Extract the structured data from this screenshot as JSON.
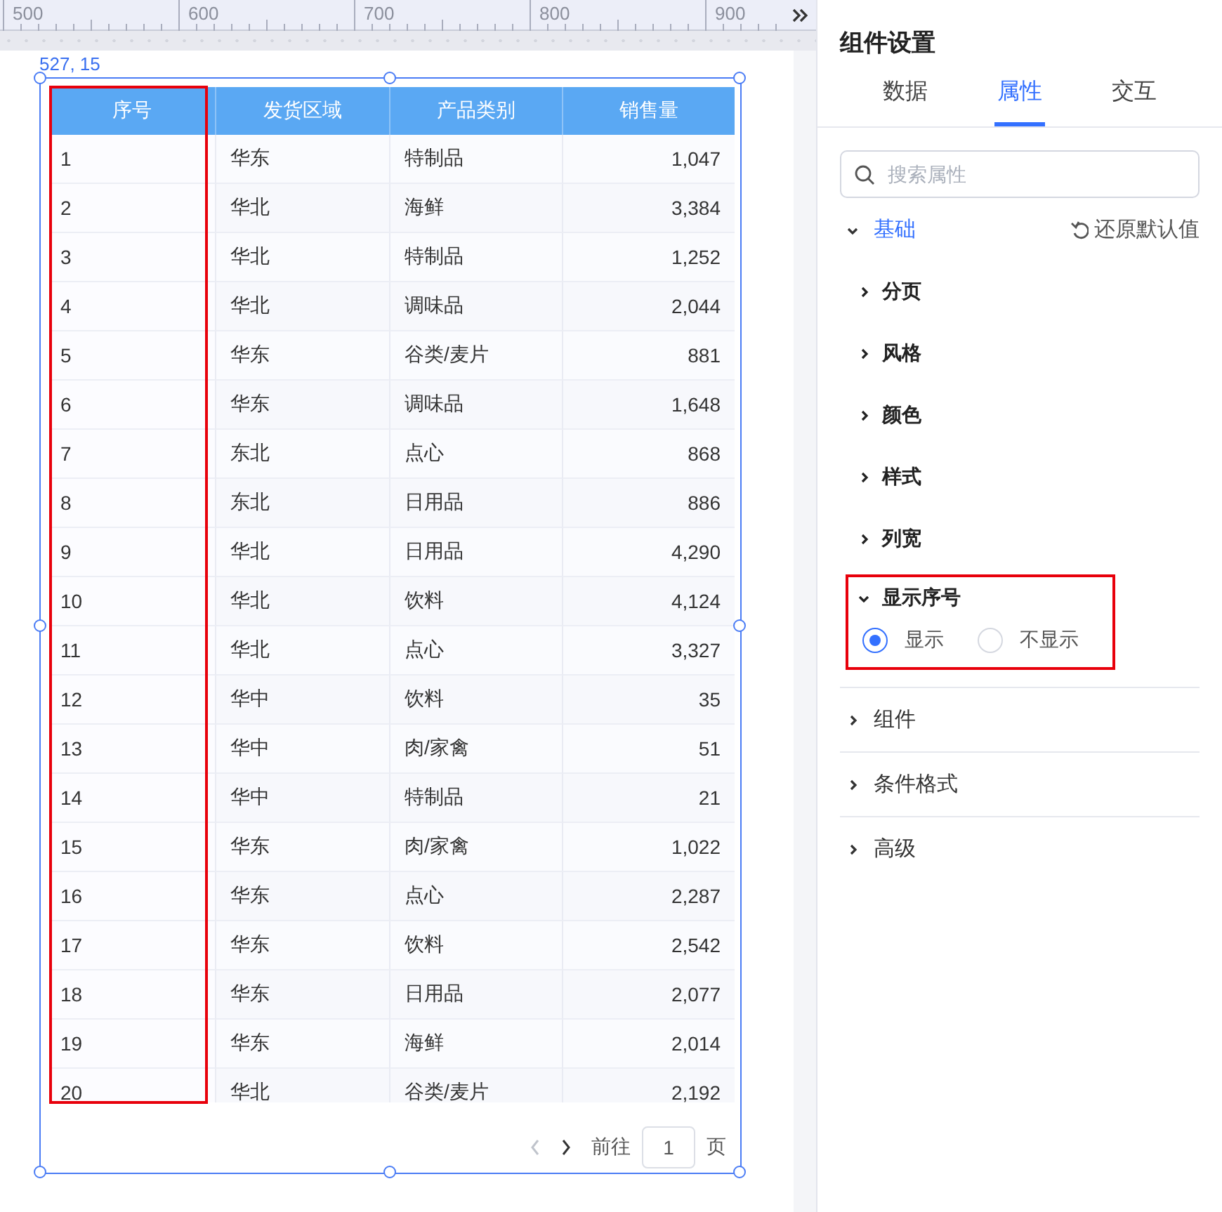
{
  "ruler": {
    "labels": [
      "500",
      "600",
      "700",
      "800",
      "900"
    ]
  },
  "canvas": {
    "coords": "527, 15",
    "table": {
      "columns": [
        {
          "label": "序号",
          "highlighted": true
        },
        {
          "label": "发货区域",
          "highlighted": false
        },
        {
          "label": "产品类别",
          "highlighted": false
        },
        {
          "label": "销售量",
          "highlighted": false
        }
      ],
      "rows": [
        [
          "1",
          "华东",
          "特制品",
          "1,047"
        ],
        [
          "2",
          "华北",
          "海鲜",
          "3,384"
        ],
        [
          "3",
          "华北",
          "特制品",
          "1,252"
        ],
        [
          "4",
          "华北",
          "调味品",
          "2,044"
        ],
        [
          "5",
          "华东",
          "谷类/麦片",
          "881"
        ],
        [
          "6",
          "华东",
          "调味品",
          "1,648"
        ],
        [
          "7",
          "东北",
          "点心",
          "868"
        ],
        [
          "8",
          "东北",
          "日用品",
          "886"
        ],
        [
          "9",
          "华北",
          "日用品",
          "4,290"
        ],
        [
          "10",
          "华北",
          "饮料",
          "4,124"
        ],
        [
          "11",
          "华北",
          "点心",
          "3,327"
        ],
        [
          "12",
          "华中",
          "饮料",
          "35"
        ],
        [
          "13",
          "华中",
          "肉/家禽",
          "51"
        ],
        [
          "14",
          "华中",
          "特制品",
          "21"
        ],
        [
          "15",
          "华东",
          "肉/家禽",
          "1,022"
        ],
        [
          "16",
          "华东",
          "点心",
          "2,287"
        ],
        [
          "17",
          "华东",
          "饮料",
          "2,542"
        ],
        [
          "18",
          "华东",
          "日用品",
          "2,077"
        ],
        [
          "19",
          "华东",
          "海鲜",
          "2,014"
        ],
        [
          "20",
          "华北",
          "谷类/麦片",
          "2,192"
        ]
      ]
    },
    "pagination": {
      "prev_disabled": true,
      "next_disabled": false,
      "goto_label": "前往",
      "page": "1",
      "page_suffix": "页"
    }
  },
  "panel": {
    "title": "组件设置",
    "tabs": [
      {
        "label": "数据",
        "selected": false
      },
      {
        "label": "属性",
        "selected": true
      },
      {
        "label": "交互",
        "selected": false
      }
    ],
    "search": {
      "placeholder": "搜索属性"
    },
    "groups": [
      {
        "label": "基础",
        "expanded": true,
        "reset": "还原默认值",
        "items": [
          {
            "label": "分页",
            "expanded": false,
            "highlighted": false
          },
          {
            "label": "风格",
            "expanded": false,
            "highlighted": false
          },
          {
            "label": "颜色",
            "expanded": false,
            "highlighted": false
          },
          {
            "label": "样式",
            "expanded": false,
            "highlighted": false
          },
          {
            "label": "列宽",
            "expanded": false,
            "highlighted": false
          },
          {
            "label": "显示序号",
            "expanded": true,
            "highlighted": true,
            "options": [
              {
                "label": "显示",
                "selected": true
              },
              {
                "label": "不显示",
                "selected": false
              }
            ]
          }
        ]
      },
      {
        "label": "组件",
        "expanded": false
      },
      {
        "label": "条件格式",
        "expanded": false
      },
      {
        "label": "高级",
        "expanded": false
      }
    ]
  }
}
